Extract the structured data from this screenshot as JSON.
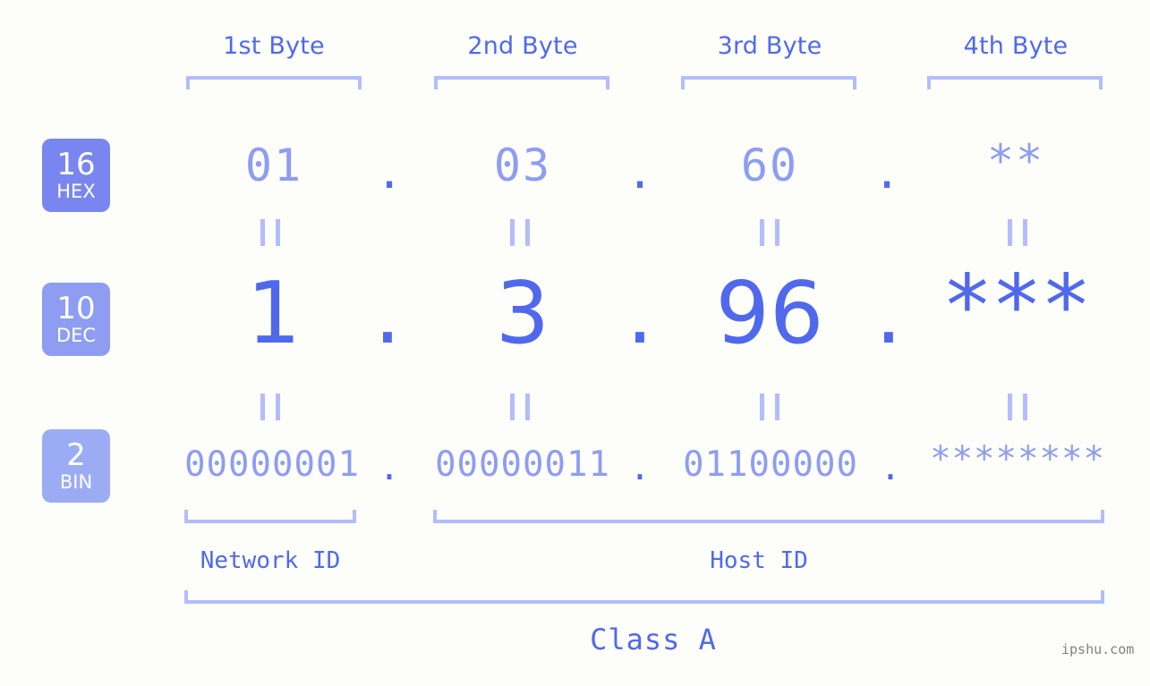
{
  "background_color": "#fdfdfa",
  "colors": {
    "accent_strong": "#5069ec",
    "accent_light": "#8e9df2",
    "bracket": "#b3bdfb",
    "badge_hex": "#7986f0",
    "badge_dec": "#8e9df2",
    "badge_bin": "#9cacf4",
    "watermark": "#808080"
  },
  "byte_headers": [
    {
      "label": "1st Byte"
    },
    {
      "label": "2nd Byte"
    },
    {
      "label": "3rd Byte"
    },
    {
      "label": "4th Byte"
    }
  ],
  "bases": [
    {
      "number": "16",
      "name": "HEX"
    },
    {
      "number": "10",
      "name": "DEC"
    },
    {
      "number": "2",
      "name": "BIN"
    }
  ],
  "rows": {
    "hex": {
      "values": [
        "01",
        "03",
        "60",
        "**"
      ],
      "separator": "."
    },
    "dec": {
      "values": [
        "1",
        "3",
        "96",
        "***"
      ],
      "separator": "."
    },
    "bin": {
      "values": [
        "00000001",
        "00000011",
        "01100000",
        "********"
      ],
      "separator": "."
    }
  },
  "equality_symbol": "=",
  "id_spans": [
    {
      "label": "Network ID"
    },
    {
      "label": "Host ID"
    }
  ],
  "class_label": "Class A",
  "watermark": "ipshu.com"
}
